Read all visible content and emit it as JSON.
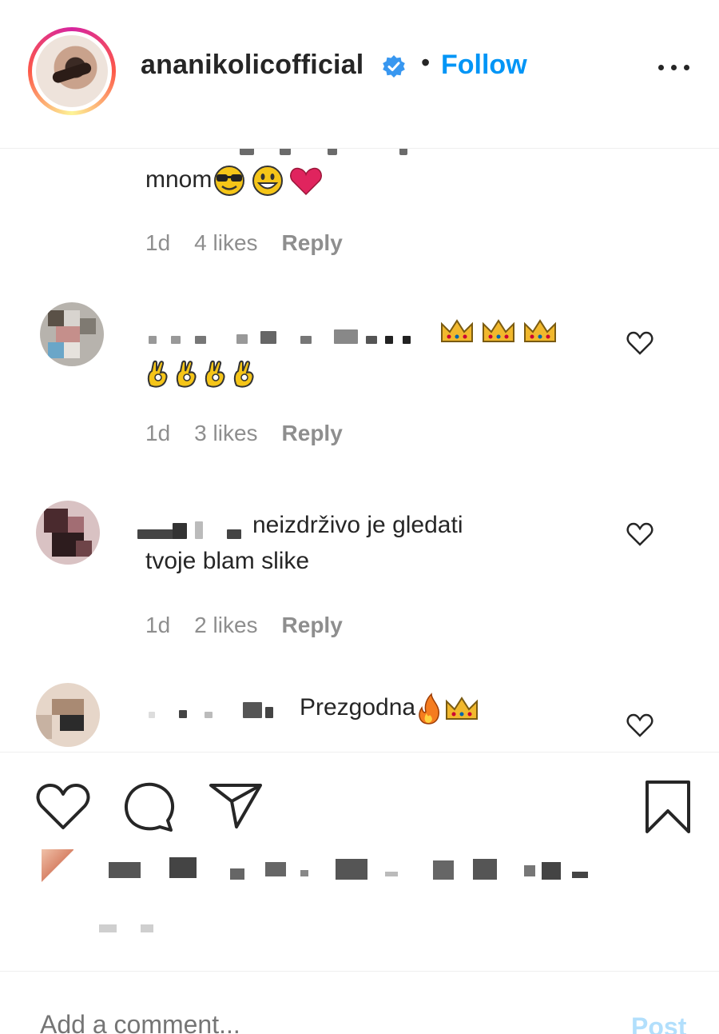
{
  "header": {
    "username": "ananikolicofficial",
    "separator": "•",
    "follow_label": "Follow",
    "verified_icon": "verified-badge-icon",
    "more_icon": "more-options-icon"
  },
  "comments": [
    {
      "text": "mnom",
      "emojis": [
        "smiling-face-with-sunglasses",
        "grinning-face",
        "red-heart"
      ],
      "time": "1d",
      "likes": "4 likes",
      "reply_label": "Reply"
    },
    {
      "text": "",
      "emojis": [
        "crown",
        "crown",
        "crown",
        "ok-hand",
        "ok-hand",
        "ok-hand",
        "ok-hand"
      ],
      "time": "1d",
      "likes": "3 likes",
      "reply_label": "Reply"
    },
    {
      "text_line1": "neizdrživo je gledati",
      "text_line2": "tvoje blam slike",
      "time": "1d",
      "likes": "2 likes",
      "reply_label": "Reply"
    },
    {
      "text": "Prezgodna",
      "emojis": [
        "fire",
        "crown"
      ]
    }
  ],
  "actions": {
    "like_icon": "heart-icon",
    "comment_icon": "comment-icon",
    "share_icon": "paper-plane-icon",
    "save_icon": "bookmark-icon"
  },
  "composer": {
    "placeholder": "Add a comment...",
    "post_label": "Post"
  },
  "colors": {
    "accent": "#0095f6",
    "text": "#262626",
    "muted": "#8e8e8e",
    "post_disabled": "#b2dffc",
    "heart_red": "#e0245e"
  }
}
